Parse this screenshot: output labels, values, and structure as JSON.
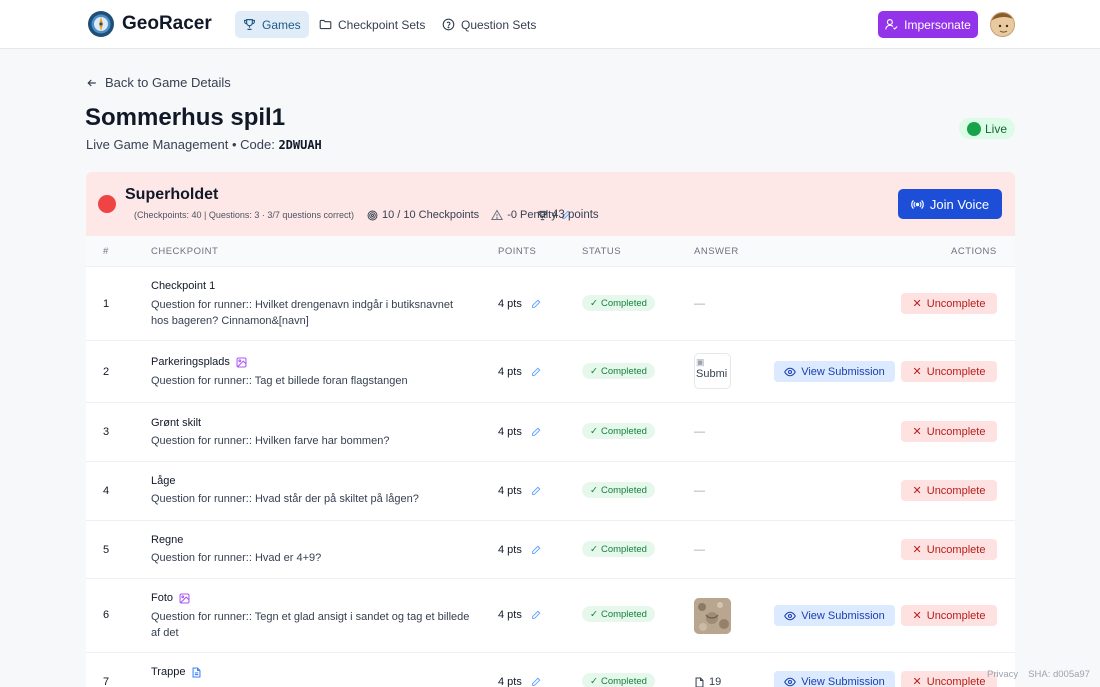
{
  "nav": {
    "brand": "GeoRacer",
    "items": [
      {
        "label": "Games",
        "icon": "trophy-icon",
        "active": true
      },
      {
        "label": "Checkpoint Sets",
        "icon": "folder-icon",
        "active": false
      },
      {
        "label": "Question Sets",
        "icon": "help-circle-icon",
        "active": false
      }
    ],
    "impersonate_label": "Impersonate"
  },
  "header": {
    "back_label": "Back to Game Details",
    "title": "Sommerhus spil1",
    "subtitle_prefix": "Live Game Management • Code: ",
    "code": "2DWUAH",
    "status_label": "Live"
  },
  "team": {
    "name": "Superholdet",
    "points": "43 points",
    "breakdown": "(Checkpoints: 40 | Questions: 3 · 3/7 questions correct)",
    "checkpoints": "10 / 10 Checkpoints",
    "penalty": "-0 Penalty",
    "join_voice_label": "Join Voice",
    "color": "#ef4444"
  },
  "table": {
    "headers": [
      "#",
      "CHECKPOINT",
      "POINTS",
      "STATUS",
      "ANSWER",
      "ACTIONS"
    ],
    "view_label": "View Submission",
    "uncomplete_label": "Uncomplete",
    "rows": [
      {
        "num": "1",
        "title": "Checkpoint 1",
        "question": "Question for runner:: Hvilket drengenavn indgår i butiksnavnet hos bageren? Cinnamon&[navn]",
        "points": "4 pts",
        "status": "Completed",
        "answer": "—"
      },
      {
        "num": "2",
        "title": "Parkeringsplads",
        "question": "Question for runner:: Tag et billede foran flagstangen",
        "points": "4 pts",
        "status": "Completed",
        "answer": "Submi"
      },
      {
        "num": "3",
        "title": "Grønt skilt",
        "question": "Question for runner:: Hvilken farve har bommen?",
        "points": "4 pts",
        "status": "Completed",
        "answer": "—"
      },
      {
        "num": "4",
        "title": "Låge",
        "question": "Question for runner:: Hvad står der på skiltet på lågen?",
        "points": "4 pts",
        "status": "Completed",
        "answer": "—"
      },
      {
        "num": "5",
        "title": "Regne",
        "question": "Question for runner:: Hvad er 4+9?",
        "points": "4 pts",
        "status": "Completed",
        "answer": "—"
      },
      {
        "num": "6",
        "title": "Foto",
        "question": "Question for runner:: Tegn et glad ansigt i sandet og tag et billede af det",
        "points": "4 pts",
        "status": "Completed",
        "answer": ""
      },
      {
        "num": "7",
        "title": "Trappe",
        "question": "",
        "points": "4 pts",
        "status": "Completed",
        "answer": "19"
      }
    ]
  },
  "footer": {
    "privacy": "Privacy",
    "sha": "SHA: d005a97"
  }
}
